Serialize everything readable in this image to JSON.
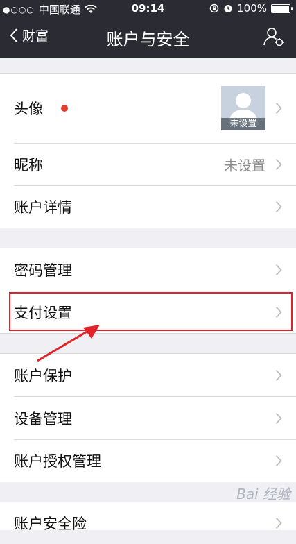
{
  "status_bar": {
    "signal_dots": "●○○○",
    "carrier": "中国联通",
    "time": "09:14",
    "battery": "100%"
  },
  "nav": {
    "back_label": "财富",
    "title": "账户与安全"
  },
  "sections": [
    {
      "items": [
        {
          "label": "头像",
          "value_badge": "未设置",
          "has_red_dot": true
        },
        {
          "label": "昵称",
          "value": "未设置"
        },
        {
          "label": "账户详情"
        }
      ]
    },
    {
      "items": [
        {
          "label": "密码管理"
        },
        {
          "label": "支付设置",
          "highlighted": true
        }
      ]
    },
    {
      "items": [
        {
          "label": "账户保护"
        },
        {
          "label": "设备管理"
        },
        {
          "label": "账户授权管理"
        }
      ]
    },
    {
      "items": [
        {
          "label": "账户安全险"
        }
      ]
    }
  ],
  "colors": {
    "nav_bg": "#2b2b34",
    "page_bg": "#efeff4",
    "red_dot": "#e43d30",
    "highlight": "#e0242a"
  },
  "watermark": "Bai 经验"
}
